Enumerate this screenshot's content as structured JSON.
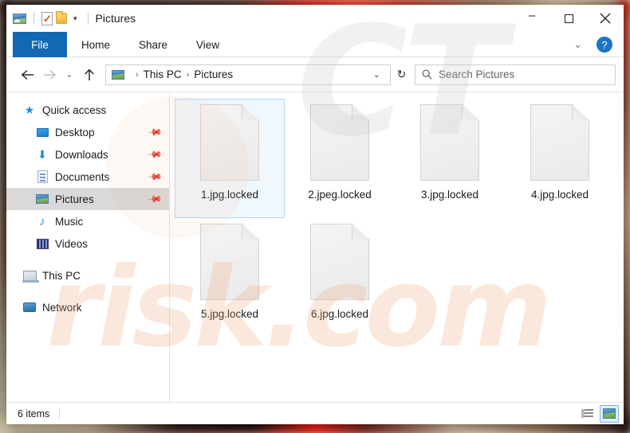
{
  "window": {
    "title": "Pictures",
    "quick_access_toolbar": [
      {
        "name": "pictures-properties-icon",
        "label": "Pictures"
      },
      {
        "name": "properties-icon",
        "label": "Properties"
      },
      {
        "name": "new-folder-icon",
        "label": "New folder"
      },
      {
        "name": "customize-caret-icon",
        "label": "▾"
      }
    ],
    "caption": {
      "minimize": "–",
      "maximize": "□",
      "close": "✕"
    }
  },
  "ribbon": {
    "tabs": [
      {
        "label": "File",
        "active": true
      },
      {
        "label": "Home",
        "active": false
      },
      {
        "label": "Share",
        "active": false
      },
      {
        "label": "View",
        "active": false
      }
    ],
    "collapse_caret": "⌄",
    "help_label": "?"
  },
  "navigation": {
    "back": "←",
    "forward": "→",
    "recent": "⌄",
    "up": "↑",
    "refresh": "↻",
    "breadcrumb": [
      "This PC",
      "Pictures"
    ],
    "breadcrumb_separator": "›",
    "address_caret": "⌄"
  },
  "search": {
    "placeholder": "Search Pictures",
    "icon": "search-icon",
    "value": ""
  },
  "sidebar": {
    "items": [
      {
        "label": "Quick access",
        "icon": "star-icon",
        "level": 0,
        "pinned": false,
        "selected": false
      },
      {
        "label": "Desktop",
        "icon": "desktop-icon",
        "level": 1,
        "pinned": true,
        "selected": false
      },
      {
        "label": "Downloads",
        "icon": "download-icon",
        "level": 1,
        "pinned": true,
        "selected": false
      },
      {
        "label": "Documents",
        "icon": "document-icon",
        "level": 1,
        "pinned": true,
        "selected": false
      },
      {
        "label": "Pictures",
        "icon": "pictures-icon",
        "level": 1,
        "pinned": true,
        "selected": true
      },
      {
        "label": "Music",
        "icon": "music-icon",
        "level": 1,
        "pinned": false,
        "selected": false
      },
      {
        "label": "Videos",
        "icon": "video-icon",
        "level": 1,
        "pinned": false,
        "selected": false
      },
      {
        "label": "This PC",
        "icon": "this-pc-icon",
        "level": 0,
        "pinned": false,
        "selected": false
      },
      {
        "label": "Network",
        "icon": "network-icon",
        "level": 0,
        "pinned": false,
        "selected": false
      }
    ],
    "pin_glyph": "✔"
  },
  "files": [
    {
      "name": "1.jpg.locked",
      "selected": true
    },
    {
      "name": "2.jpeg.locked",
      "selected": false
    },
    {
      "name": "3.jpg.locked",
      "selected": false
    },
    {
      "name": "4.jpg.locked",
      "selected": false
    },
    {
      "name": "5.jpg.locked",
      "selected": false
    },
    {
      "name": "6.jpg.locked",
      "selected": false
    }
  ],
  "statusbar": {
    "item_count": "6 items",
    "views": [
      {
        "name": "details-view-button",
        "active": false
      },
      {
        "name": "large-icons-view-button",
        "active": true
      }
    ]
  },
  "watermark": {
    "top_text": "CT",
    "bottom_text": "risk.com"
  },
  "colors": {
    "accent_blue": "#1268b3",
    "selection_fill": "#f0f7fd",
    "selection_border": "#b7d8f0",
    "sidebar_selected": "#d9d9d9",
    "help_blue": "#1a75c4"
  }
}
